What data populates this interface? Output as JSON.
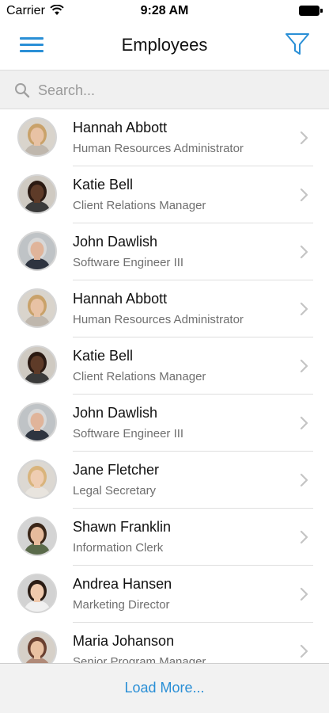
{
  "status_bar": {
    "carrier": "Carrier",
    "time": "9:28 AM"
  },
  "nav": {
    "title": "Employees",
    "menu_icon": "hamburger-menu-icon",
    "filter_icon": "filter-funnel-icon"
  },
  "search": {
    "placeholder": "Search...",
    "value": ""
  },
  "employees": [
    {
      "name": "Hannah Abbott",
      "title": "Human Resources Administrator",
      "avatar": {
        "skin": "#e8c2a4",
        "hair": "#c9a26a",
        "bg": "#d9d4cc",
        "shirt": "#bfb7ad"
      }
    },
    {
      "name": "Katie Bell",
      "title": "Client Relations Manager",
      "avatar": {
        "skin": "#5e3b28",
        "hair": "#2b1a12",
        "bg": "#cfcac2",
        "shirt": "#3a3a3a"
      }
    },
    {
      "name": "John Dawlish",
      "title": "Software Engineer III",
      "avatar": {
        "skin": "#e0b49a",
        "hair": "#d8d8d8",
        "bg": "#bfc3c6",
        "shirt": "#2e3440"
      }
    },
    {
      "name": "Hannah Abbott",
      "title": "Human Resources Administrator",
      "avatar": {
        "skin": "#e8c2a4",
        "hair": "#c9a26a",
        "bg": "#d9d4cc",
        "shirt": "#bfb7ad"
      }
    },
    {
      "name": "Katie Bell",
      "title": "Client Relations Manager",
      "avatar": {
        "skin": "#5e3b28",
        "hair": "#2b1a12",
        "bg": "#cfcac2",
        "shirt": "#3a3a3a"
      }
    },
    {
      "name": "John Dawlish",
      "title": "Software Engineer III",
      "avatar": {
        "skin": "#e0b49a",
        "hair": "#d8d8d8",
        "bg": "#bfc3c6",
        "shirt": "#2e3440"
      }
    },
    {
      "name": "Jane Fletcher",
      "title": "Legal Secretary",
      "avatar": {
        "skin": "#efcdb2",
        "hair": "#d9b47c",
        "bg": "#dcd8d2",
        "shirt": "#e8e4de"
      }
    },
    {
      "name": "Shawn Franklin",
      "title": "Information Clerk",
      "avatar": {
        "skin": "#e6bb9c",
        "hair": "#3a2618",
        "bg": "#d4d4d4",
        "shirt": "#5a6a4a"
      }
    },
    {
      "name": "Andrea Hansen",
      "title": "Marketing Director",
      "avatar": {
        "skin": "#efc9ad",
        "hair": "#2a1c14",
        "bg": "#d2d2d2",
        "shirt": "#f0f0f0"
      }
    },
    {
      "name": "Maria Johanson",
      "title": "Senior Program Manager",
      "avatar": {
        "skin": "#e9c1a2",
        "hair": "#6a4030",
        "bg": "#d6d0c8",
        "shirt": "#b08a78"
      }
    }
  ],
  "footer": {
    "load_more_label": "Load More..."
  },
  "colors": {
    "accent": "#2a8fd6",
    "secondary_text": "#6f6f6f",
    "divider": "#dedede"
  }
}
